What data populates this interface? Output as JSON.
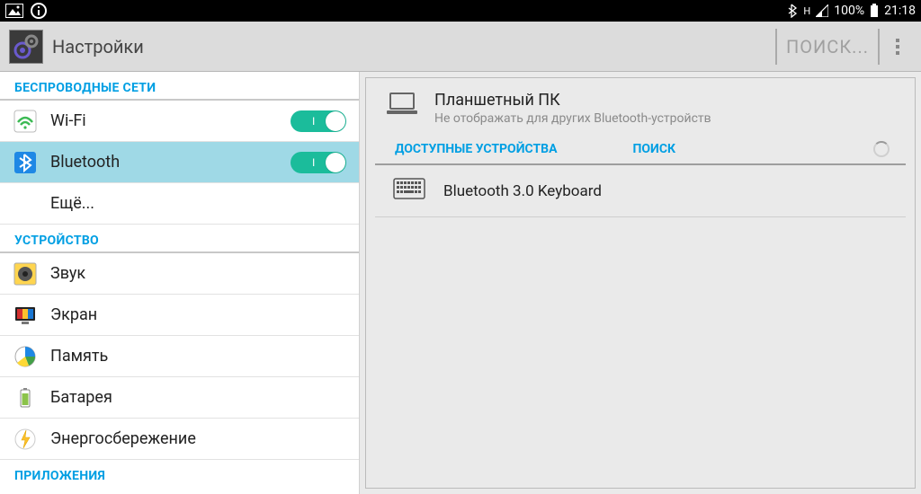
{
  "status_bar": {
    "battery_percent": "100%",
    "clock": "21:18",
    "signal_label": "H"
  },
  "action_bar": {
    "title": "Настройки",
    "search_placeholder": "ПОИСК..."
  },
  "sidebar": {
    "section_wireless": "БЕСПРОВОДНЫЕ СЕТИ",
    "wifi_label": "Wi-Fi",
    "bluetooth_label": "Bluetooth",
    "more_label": "Ещё...",
    "section_device": "УСТРОЙСТВО",
    "sound_label": "Звук",
    "display_label": "Экран",
    "storage_label": "Память",
    "battery_label": "Батарея",
    "power_label": "Энергосбережение",
    "section_apps": "ПРИЛОЖЕНИЯ"
  },
  "detail": {
    "device_name": "Планшетный ПК",
    "device_subtitle": "Не отображать для других Bluetooth-устройств",
    "tab_available": "ДОСТУПНЫЕ УСТРОЙСТВА",
    "tab_search": "ПОИСК",
    "found_device": "Bluetooth 3.0 Keyboard"
  }
}
